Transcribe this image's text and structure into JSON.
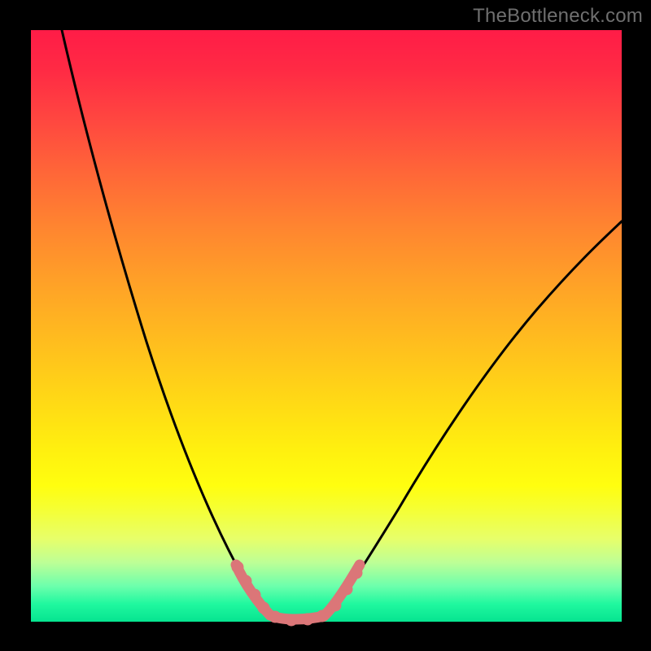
{
  "watermark": "TheBottleneck.com",
  "chart_data": {
    "type": "line",
    "title": "",
    "xlabel": "",
    "ylabel": "",
    "xlim": [
      0,
      100
    ],
    "ylim": [
      0,
      100
    ],
    "grid": false,
    "note": "Axes are unlabeled. Values below are estimated pixel-space coordinates (x,y) normalized to the 726x727 plot area, representing the black curve height from bottom (y=0) to top (y=100).",
    "series": [
      {
        "name": "left-branch",
        "x": [
          5,
          8,
          12,
          16,
          20,
          24,
          28,
          31,
          34,
          36,
          38,
          40
        ],
        "y": [
          100,
          88,
          74,
          60,
          46,
          34,
          23,
          14,
          8,
          4,
          1,
          0
        ]
      },
      {
        "name": "right-branch",
        "x": [
          46,
          48,
          51,
          55,
          60,
          66,
          73,
          81,
          90,
          100
        ],
        "y": [
          0,
          2,
          7,
          14,
          23,
          33,
          43,
          53,
          62,
          70
        ]
      },
      {
        "name": "pink-left-segment",
        "x": [
          34.5,
          40
        ],
        "y": [
          8,
          0
        ]
      },
      {
        "name": "pink-floor",
        "x": [
          40,
          46
        ],
        "y": [
          0,
          0
        ]
      },
      {
        "name": "pink-right-segment",
        "x": [
          46,
          51.5
        ],
        "y": [
          0,
          8
        ]
      }
    ]
  },
  "colors": {
    "black_curve": "#000000",
    "pink_overlay": "#db7678",
    "frame": "#000000"
  }
}
